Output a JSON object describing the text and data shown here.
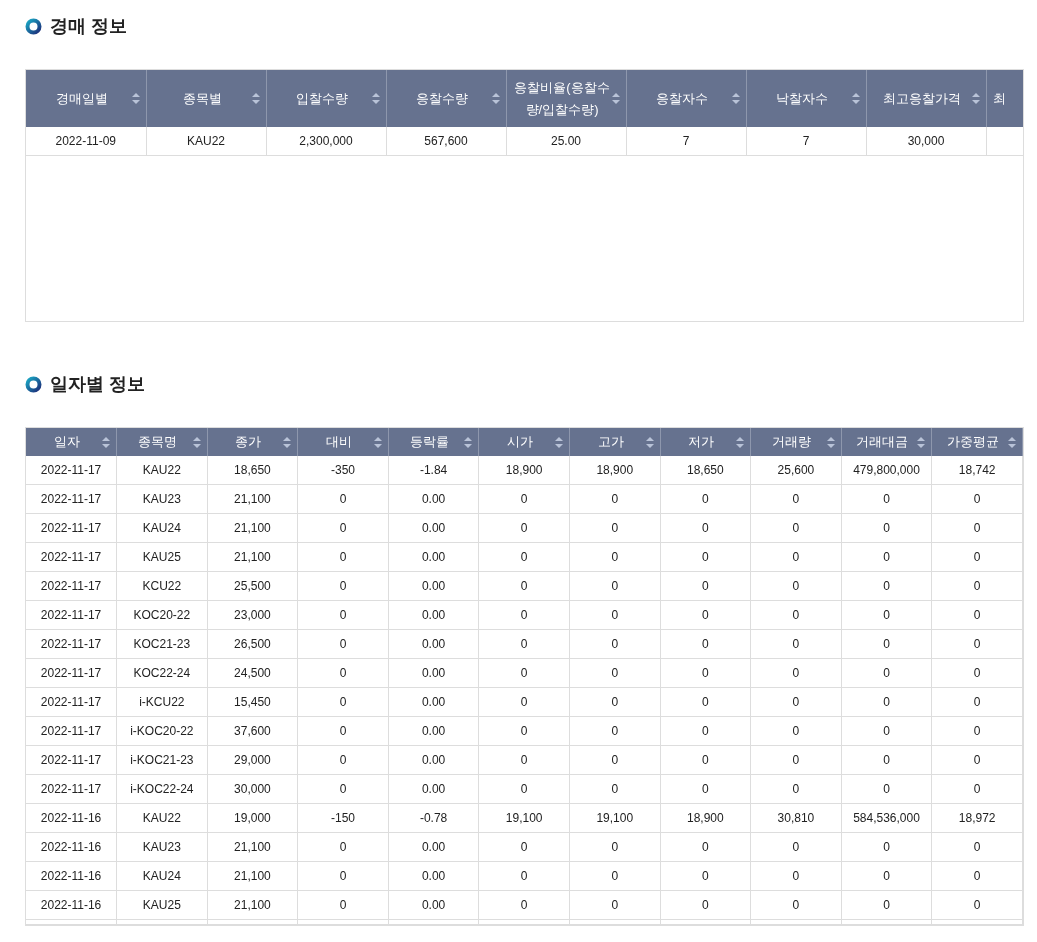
{
  "auction": {
    "title": "경매 정보",
    "columns": [
      {
        "label": "경매일별",
        "sortable": true
      },
      {
        "label": "종목별",
        "sortable": true
      },
      {
        "label": "입찰수량",
        "sortable": true
      },
      {
        "label": "응찰수량",
        "sortable": true
      },
      {
        "label": "응찰비율(응찰수량/입찰수량)",
        "sortable": true
      },
      {
        "label": "응찰자수",
        "sortable": true
      },
      {
        "label": "낙찰자수",
        "sortable": true
      },
      {
        "label": "최고응찰가격",
        "sortable": true
      },
      {
        "label": "최",
        "sortable": false
      }
    ],
    "rows": [
      [
        "2022-11-09",
        "KAU22",
        "2,300,000",
        "567,600",
        "25.00",
        "7",
        "7",
        "30,000"
      ]
    ]
  },
  "daily": {
    "title": "일자별 정보",
    "columns": [
      "일자",
      "종목명",
      "종가",
      "대비",
      "등락률",
      "시가",
      "고가",
      "저가",
      "거래량",
      "거래대금",
      "가중평균"
    ],
    "rows": [
      [
        "2022-11-17",
        "KAU22",
        "18,650",
        "-350",
        "-1.84",
        "18,900",
        "18,900",
        "18,650",
        "25,600",
        "479,800,000",
        "18,742"
      ],
      [
        "2022-11-17",
        "KAU23",
        "21,100",
        "0",
        "0.00",
        "0",
        "0",
        "0",
        "0",
        "0",
        "0"
      ],
      [
        "2022-11-17",
        "KAU24",
        "21,100",
        "0",
        "0.00",
        "0",
        "0",
        "0",
        "0",
        "0",
        "0"
      ],
      [
        "2022-11-17",
        "KAU25",
        "21,100",
        "0",
        "0.00",
        "0",
        "0",
        "0",
        "0",
        "0",
        "0"
      ],
      [
        "2022-11-17",
        "KCU22",
        "25,500",
        "0",
        "0.00",
        "0",
        "0",
        "0",
        "0",
        "0",
        "0"
      ],
      [
        "2022-11-17",
        "KOC20-22",
        "23,000",
        "0",
        "0.00",
        "0",
        "0",
        "0",
        "0",
        "0",
        "0"
      ],
      [
        "2022-11-17",
        "KOC21-23",
        "26,500",
        "0",
        "0.00",
        "0",
        "0",
        "0",
        "0",
        "0",
        "0"
      ],
      [
        "2022-11-17",
        "KOC22-24",
        "24,500",
        "0",
        "0.00",
        "0",
        "0",
        "0",
        "0",
        "0",
        "0"
      ],
      [
        "2022-11-17",
        "i-KCU22",
        "15,450",
        "0",
        "0.00",
        "0",
        "0",
        "0",
        "0",
        "0",
        "0"
      ],
      [
        "2022-11-17",
        "i-KOC20-22",
        "37,600",
        "0",
        "0.00",
        "0",
        "0",
        "0",
        "0",
        "0",
        "0"
      ],
      [
        "2022-11-17",
        "i-KOC21-23",
        "29,000",
        "0",
        "0.00",
        "0",
        "0",
        "0",
        "0",
        "0",
        "0"
      ],
      [
        "2022-11-17",
        "i-KOC22-24",
        "30,000",
        "0",
        "0.00",
        "0",
        "0",
        "0",
        "0",
        "0",
        "0"
      ],
      [
        "2022-11-16",
        "KAU22",
        "19,000",
        "-150",
        "-0.78",
        "19,100",
        "19,100",
        "18,900",
        "30,810",
        "584,536,000",
        "18,972"
      ],
      [
        "2022-11-16",
        "KAU23",
        "21,100",
        "0",
        "0.00",
        "0",
        "0",
        "0",
        "0",
        "0",
        "0"
      ],
      [
        "2022-11-16",
        "KAU24",
        "21,100",
        "0",
        "0.00",
        "0",
        "0",
        "0",
        "0",
        "0",
        "0"
      ],
      [
        "2022-11-16",
        "KAU25",
        "21,100",
        "0",
        "0.00",
        "0",
        "0",
        "0",
        "0",
        "0",
        "0"
      ]
    ]
  }
}
